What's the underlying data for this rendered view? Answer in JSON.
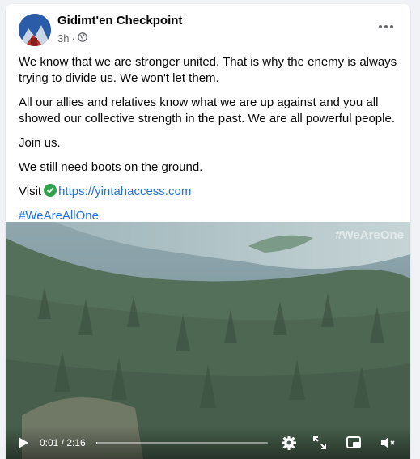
{
  "post": {
    "page_name": "Gidimt'en Checkpoint",
    "time": "3h",
    "separator": "·",
    "paragraphs": [
      "We know that we are stronger united. That is why the enemy is always trying to divide us. We won't let them.",
      "All our allies and relatives know what we are up against and you all showed our collective strength in the past. We are all powerful people.",
      "Join us.",
      "We still need boots on the ground."
    ],
    "visit_label": "Visit",
    "visit_url": "https://yintahaccess.com",
    "hashtag": "#WeAreAllOne"
  },
  "video": {
    "watermark": "#WeAreOne",
    "time_display": "0:01 / 2:16",
    "progress_fraction": 0.007
  },
  "icons": {
    "privacy": "globe-icon",
    "verified": "check-circle-icon",
    "more": "more-options-icon",
    "play": "play-icon",
    "settings": "gear-icon",
    "fullscreen": "expand-icon",
    "pip": "picture-in-picture-icon",
    "volume": "mute-icon"
  },
  "colors": {
    "link": "#216fdb",
    "verified": "#31a24c",
    "secondary_text": "#65676b"
  }
}
